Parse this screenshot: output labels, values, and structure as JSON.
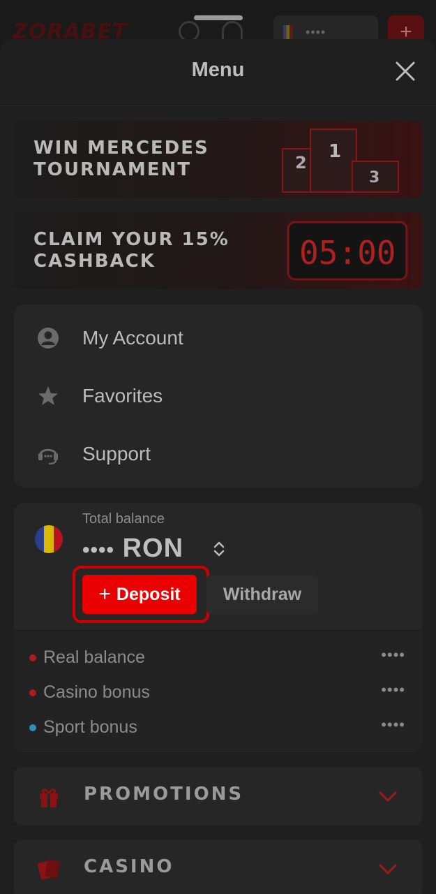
{
  "background": {
    "logo": "ZORABET",
    "balance_masked": "••••"
  },
  "menu": {
    "title": "Menu"
  },
  "banners": [
    {
      "text": "WIN MERCEDES TOURNAMENT",
      "art": [
        "1",
        "2",
        "3"
      ]
    },
    {
      "text": "CLAIM YOUR 15% CASHBACK",
      "art": [
        "05:00"
      ]
    }
  ],
  "account_menu": [
    {
      "label": "My Account",
      "icon": "user-circle-icon"
    },
    {
      "label": "Favorites",
      "icon": "star-icon"
    },
    {
      "label": "Support",
      "icon": "headset-icon"
    }
  ],
  "balance": {
    "label": "Total balance",
    "amount_masked": "••••",
    "currency": "RON",
    "deposit_label": "Deposit",
    "withdraw_label": "Withdraw",
    "items": [
      {
        "label": "Real balance",
        "value": "••••",
        "dot_color": "#b01a1a"
      },
      {
        "label": "Casino bonus",
        "value": "••••",
        "dot_color": "#b01a1a"
      },
      {
        "label": "Sport bonus",
        "value": "••••",
        "dot_color": "#2e8fb8"
      }
    ]
  },
  "sections": [
    {
      "label": "PROMOTIONS",
      "icon": "gift-icon"
    },
    {
      "label": "CASINO",
      "icon": "cards-icon"
    }
  ],
  "colors": {
    "accent": "#ea0000",
    "highlight": "#d00000",
    "surface": "#262626"
  }
}
